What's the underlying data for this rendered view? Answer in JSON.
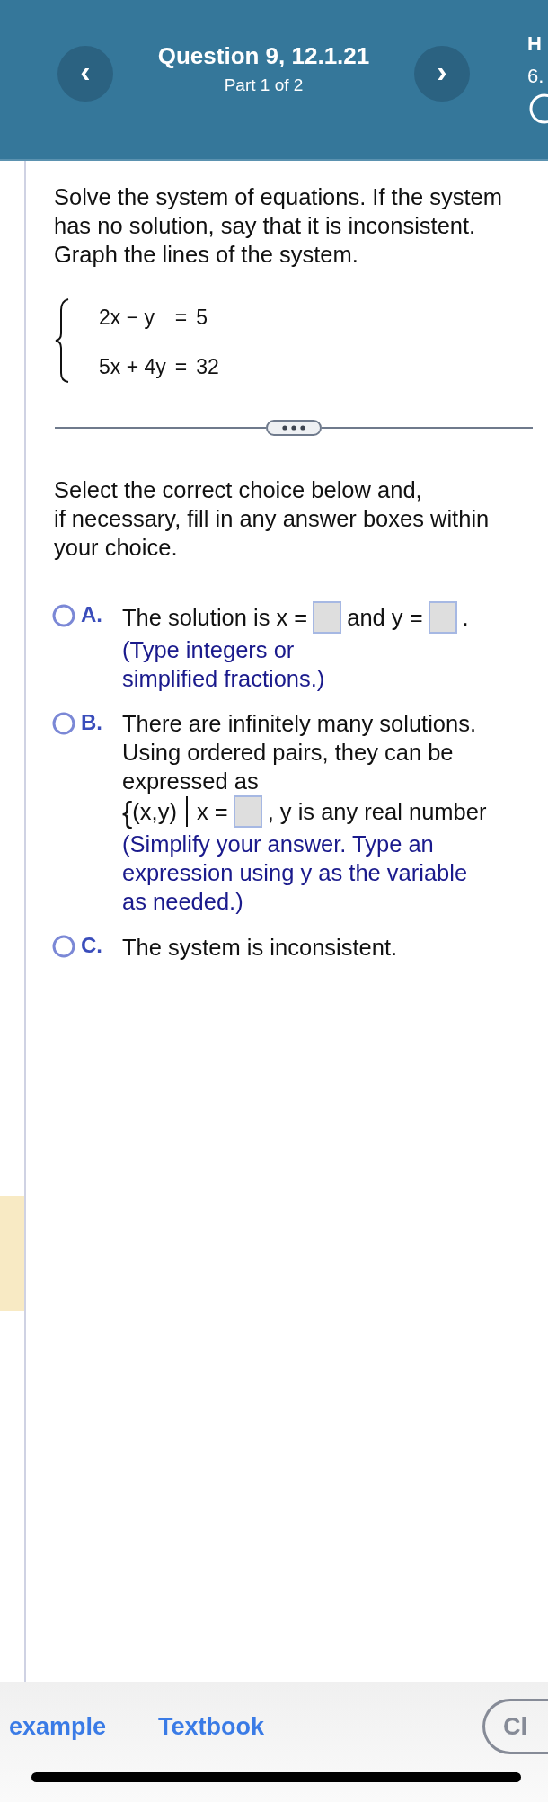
{
  "header": {
    "prev_label": "‹",
    "title": "Question 9, 12.1.21",
    "subtitle": "Part 1 of 2",
    "next_label": "›",
    "side_title": "H",
    "side_score": "6."
  },
  "question": {
    "lines": [
      "Solve the system of equations. If the system",
      "has no solution, say that it is inconsistent.",
      "Graph the lines of the system."
    ],
    "equations": [
      {
        "lhs": "2x − y",
        "rel": "=",
        "rhs": "5"
      },
      {
        "lhs": "5x + 4y",
        "rel": "=",
        "rhs": "32"
      }
    ]
  },
  "instruction": [
    "Select the correct choice below and,",
    "if necessary, fill in any answer boxes within",
    "your choice."
  ],
  "choices": [
    {
      "letter": "A.",
      "selected": false,
      "body": [
        {
          "kind": "text",
          "text": "The solution is x ="
        },
        {
          "kind": "field"
        },
        {
          "kind": "text",
          "text": "and y ="
        },
        {
          "kind": "field"
        },
        {
          "kind": "text",
          "text": "."
        }
      ],
      "hint": [
        "(Type integers or",
        "simplified fractions.)"
      ]
    },
    {
      "letter": "B.",
      "selected": false,
      "intro": [
        "There are infinitely many solutions.",
        "Using ordered pairs, they can be",
        "expressed as"
      ],
      "body": [
        {
          "kind": "brace",
          "text": "{"
        },
        {
          "kind": "text",
          "text": "(x,y)"
        },
        {
          "kind": "bar"
        },
        {
          "kind": "text",
          "text": "x ="
        },
        {
          "kind": "field"
        },
        {
          "kind": "text",
          "text": ", y is any real number"
        }
      ],
      "hint": [
        "(Simplify your answer. Type an",
        "expression using y as the variable",
        "as needed.)"
      ]
    },
    {
      "letter": "C.",
      "selected": false,
      "body": [
        {
          "kind": "text",
          "text": "The system is inconsistent."
        }
      ]
    }
  ],
  "footer": {
    "links": [
      "example",
      "Textbook"
    ],
    "close_label": "Cl"
  }
}
